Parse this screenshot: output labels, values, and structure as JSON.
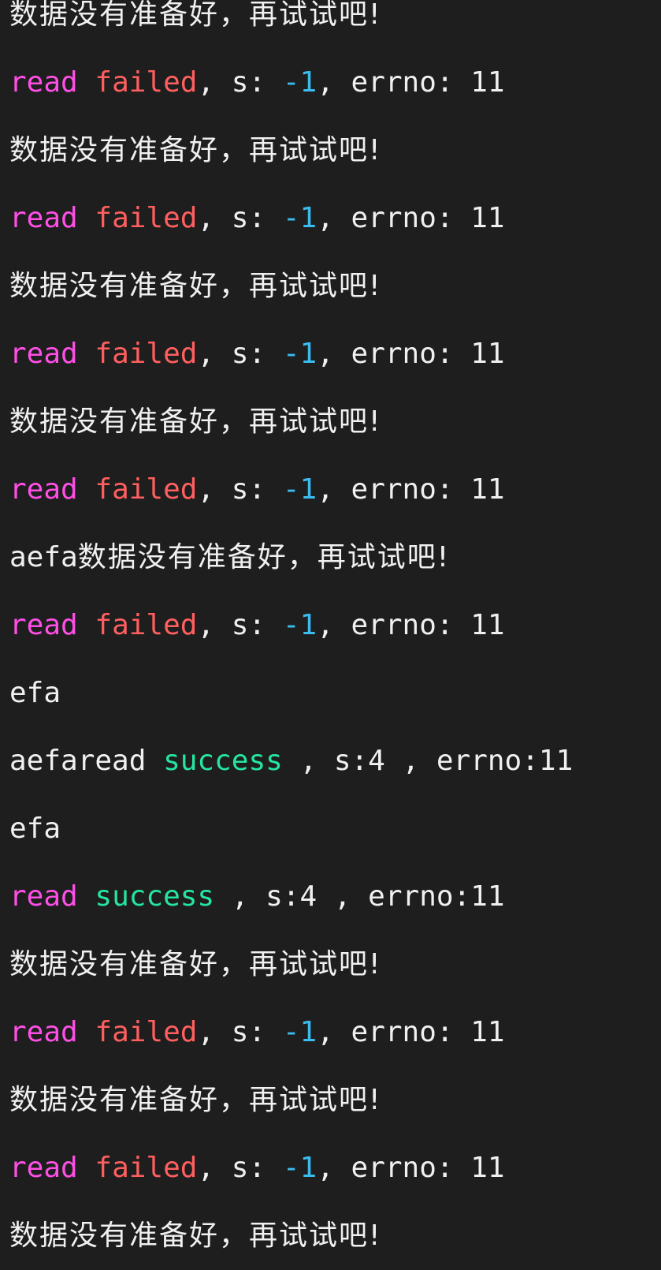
{
  "terminal": {
    "lines": [
      {
        "kind": "cjk",
        "text": "数据没有准备好，再试试吧!"
      },
      {
        "kind": "failed",
        "read": "read",
        "status": "failed",
        "sep1": ", s: ",
        "s_val": "-1",
        "sep2": ", errno: ",
        "errno": "11"
      },
      {
        "kind": "cjk",
        "text": "数据没有准备好，再试试吧!"
      },
      {
        "kind": "failed",
        "read": "read",
        "status": "failed",
        "sep1": ", s: ",
        "s_val": "-1",
        "sep2": ", errno: ",
        "errno": "11"
      },
      {
        "kind": "cjk",
        "text": "数据没有准备好，再试试吧!"
      },
      {
        "kind": "failed",
        "read": "read",
        "status": "failed",
        "sep1": ", s: ",
        "s_val": "-1",
        "sep2": ", errno: ",
        "errno": "11"
      },
      {
        "kind": "cjk",
        "text": "数据没有准备好，再试试吧!"
      },
      {
        "kind": "failed",
        "read": "read",
        "status": "failed",
        "sep1": ", s: ",
        "s_val": "-1",
        "sep2": ", errno: ",
        "errno": "11"
      },
      {
        "kind": "prefix_cjk",
        "prefix": "aefa",
        "text": "数据没有准备好，再试试吧!"
      },
      {
        "kind": "failed",
        "read": "read",
        "status": "failed",
        "sep1": ", s: ",
        "s_val": "-1",
        "sep2": ", errno: ",
        "errno": "11"
      },
      {
        "kind": "plain",
        "text": "efa"
      },
      {
        "kind": "success_prefixed",
        "prefix": "aefaread ",
        "status": "success",
        "rest": " , s:4 , errno:11"
      },
      {
        "kind": "plain",
        "text": "efa"
      },
      {
        "kind": "success",
        "read": "read",
        "status": "success",
        "rest": " , s:4 , errno:11"
      },
      {
        "kind": "cjk",
        "text": "数据没有准备好，再试试吧!"
      },
      {
        "kind": "failed",
        "read": "read",
        "status": "failed",
        "sep1": ", s: ",
        "s_val": "-1",
        "sep2": ", errno: ",
        "errno": "11"
      },
      {
        "kind": "cjk",
        "text": "数据没有准备好，再试试吧!"
      },
      {
        "kind": "failed",
        "read": "read",
        "status": "failed",
        "sep1": ", s: ",
        "s_val": "-1",
        "sep2": ", errno: ",
        "errno": "11"
      },
      {
        "kind": "cjk",
        "text": "数据没有准备好，再试试吧!"
      }
    ]
  },
  "colors": {
    "background": "#1e1e1e",
    "text": "#f0f0f0",
    "read": "#ff4fe6",
    "failed": "#ff5f5f",
    "negative": "#3bbcf0",
    "success": "#25e6a0"
  }
}
